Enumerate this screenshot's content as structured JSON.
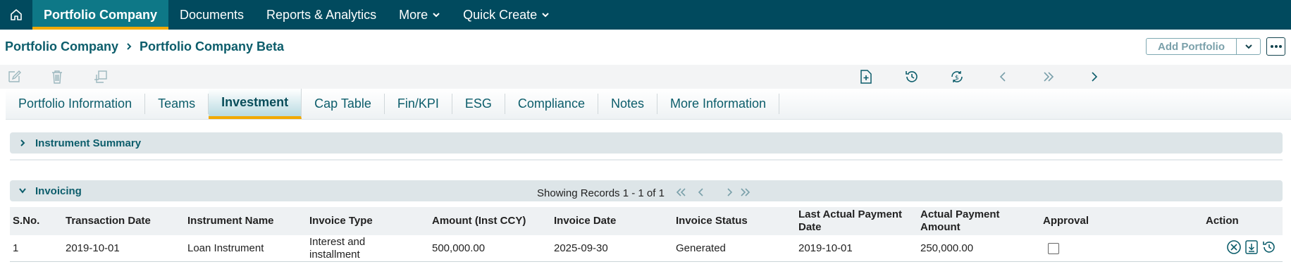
{
  "topnav": {
    "items": [
      {
        "label": "Portfolio Company"
      },
      {
        "label": "Documents"
      },
      {
        "label": "Reports & Analytics"
      },
      {
        "label": "More"
      },
      {
        "label": "Quick Create"
      }
    ],
    "active": "Portfolio Company"
  },
  "breadcrumb": {
    "root": "Portfolio Company",
    "current": "Portfolio Company Beta"
  },
  "actions": {
    "add_portfolio": "Add Portfolio"
  },
  "tabs": [
    {
      "label": "Portfolio Information"
    },
    {
      "label": "Teams"
    },
    {
      "label": "Investment"
    },
    {
      "label": "Cap Table"
    },
    {
      "label": "Fin/KPI"
    },
    {
      "label": "ESG"
    },
    {
      "label": "Compliance"
    },
    {
      "label": "Notes"
    },
    {
      "label": "More Information"
    }
  ],
  "active_tab": "Investment",
  "sections": {
    "instrument_summary": "Instrument Summary",
    "invoicing": "Invoicing"
  },
  "pager": {
    "text": "Showing Records 1 - 1 of 1"
  },
  "table": {
    "columns": [
      "S.No.",
      "Transaction Date",
      "Instrument Name",
      "Invoice Type",
      "Amount (Inst CCY)",
      "Invoice Date",
      "Invoice Status",
      "Last Actual Payment Date",
      "Actual Payment Amount",
      "Approval",
      "Action"
    ],
    "rows": [
      {
        "sno": "1",
        "transaction_date": "2019-10-01",
        "instrument_name": "Loan Instrument",
        "invoice_type": "Interest and installment",
        "amount": "500,000.00",
        "invoice_date": "2025-09-30",
        "invoice_status": "Generated",
        "last_payment_date": "2019-10-01",
        "payment_amount": "250,000.00",
        "approved": false
      }
    ]
  },
  "colors": {
    "nav_bg": "#014a5e",
    "nav_active": "#0e7887",
    "accent": "#f2a900",
    "link": "#0c5d6b"
  }
}
